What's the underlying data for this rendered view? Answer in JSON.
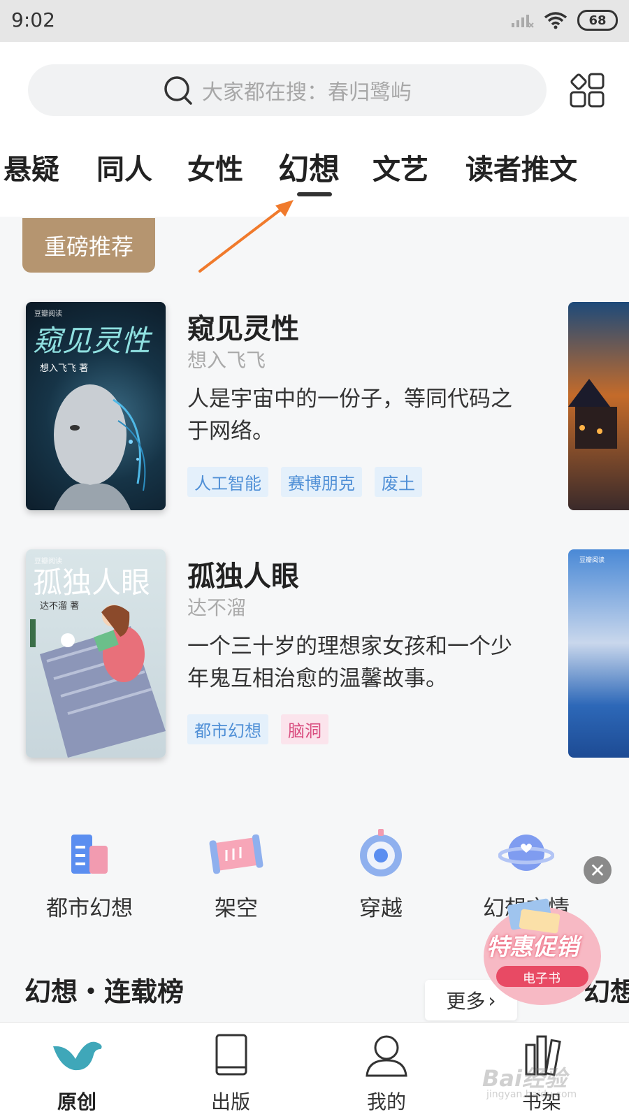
{
  "status_bar": {
    "time": "9:02",
    "battery": "68"
  },
  "search": {
    "placeholder": "大家都在搜：春归鹭屿"
  },
  "tabs": [
    "悬疑",
    "同人",
    "女性",
    "幻想",
    "文艺",
    "读者推文"
  ],
  "active_tab": "幻想",
  "featured": {
    "badge": "重磅推荐",
    "books": [
      {
        "title": "窥见灵性",
        "author": "想入飞飞",
        "description": "人是宇宙中的一份子，等同代码之于网络。",
        "tags": [
          "人工智能",
          "赛博朋克",
          "废土"
        ],
        "cover_title": "窥见灵性",
        "cover_author": "想入飞飞 著",
        "cover_brand": "豆瓣阅读"
      },
      {
        "title": "孤独人眼",
        "author": "达不溜",
        "description": "一个三十岁的理想家女孩和一个少年鬼互相治愈的温馨故事。",
        "tags": [
          "都市幻想",
          "脑洞"
        ],
        "cover_title": "孤独人眼",
        "cover_author": "达不溜 著",
        "cover_brand": "豆瓣阅读"
      }
    ],
    "peek_brand": "豆瓣阅读"
  },
  "categories": [
    "都市幻想",
    "架空",
    "穿越",
    "幻想言情"
  ],
  "promo": {
    "title": "特惠促销",
    "subtitle": "电子书"
  },
  "ranking": {
    "title": "幻想・连载榜",
    "more": "更多",
    "next_title": "幻想"
  },
  "bottom_nav": [
    "原创",
    "出版",
    "我的",
    "书架"
  ],
  "watermark": {
    "main": "Bai经验",
    "sub": "jingyan.baidu.com"
  },
  "colors": {
    "badge": "#b59570",
    "arrow": "#f07a2c",
    "tag_blue": "#4f8fd6",
    "tag_pink": "#d94d7f",
    "logo_teal": "#3fa7b9"
  }
}
